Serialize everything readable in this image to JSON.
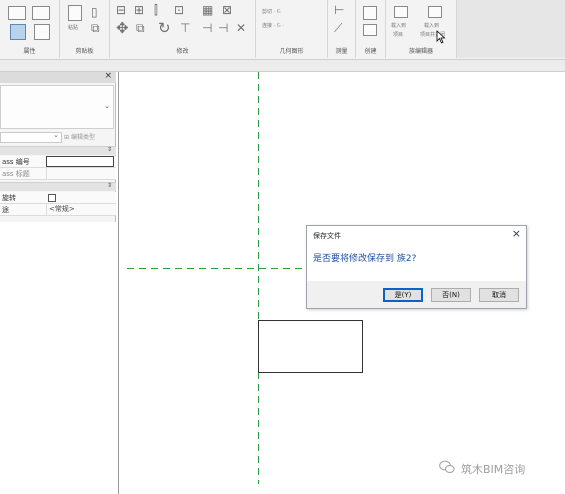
{
  "ribbon": {
    "groups": [
      "属性",
      "剪贴板",
      "修改",
      "几何图形",
      "测量",
      "创建",
      "族编辑器"
    ],
    "tiny_labels": {
      "paste": "粘贴",
      "cut": "剪切 · 𝔾",
      "join": "连接 · 𝔾 ·",
      "load1": "载入到",
      "load1b": "项目",
      "load2": "载入到",
      "load2b": "项目并关闭"
    }
  },
  "properties_panel": {
    "close_glyph": "×",
    "filter_arrow": "⌄",
    "edit_type": "编辑类型",
    "rows": [
      {
        "label": "ass 编号",
        "value": ""
      },
      {
        "label": "ass 标题",
        "value": ""
      },
      {
        "label": "旋转",
        "value": ""
      },
      {
        "label": "途",
        "value": "<常规>"
      }
    ]
  },
  "dialog": {
    "title": "保存文件",
    "close": "×",
    "message": "是否要将修改保存到 族2?",
    "buttons": {
      "yes": "是(Y)",
      "no": "否(N)",
      "cancel": "取消"
    }
  },
  "watermark": "筑木BIM咨询",
  "colors": {
    "ref_line": "#2e9a3c",
    "dialog_message": "#1f4fa0",
    "default_button_border": "#0a64c8"
  }
}
